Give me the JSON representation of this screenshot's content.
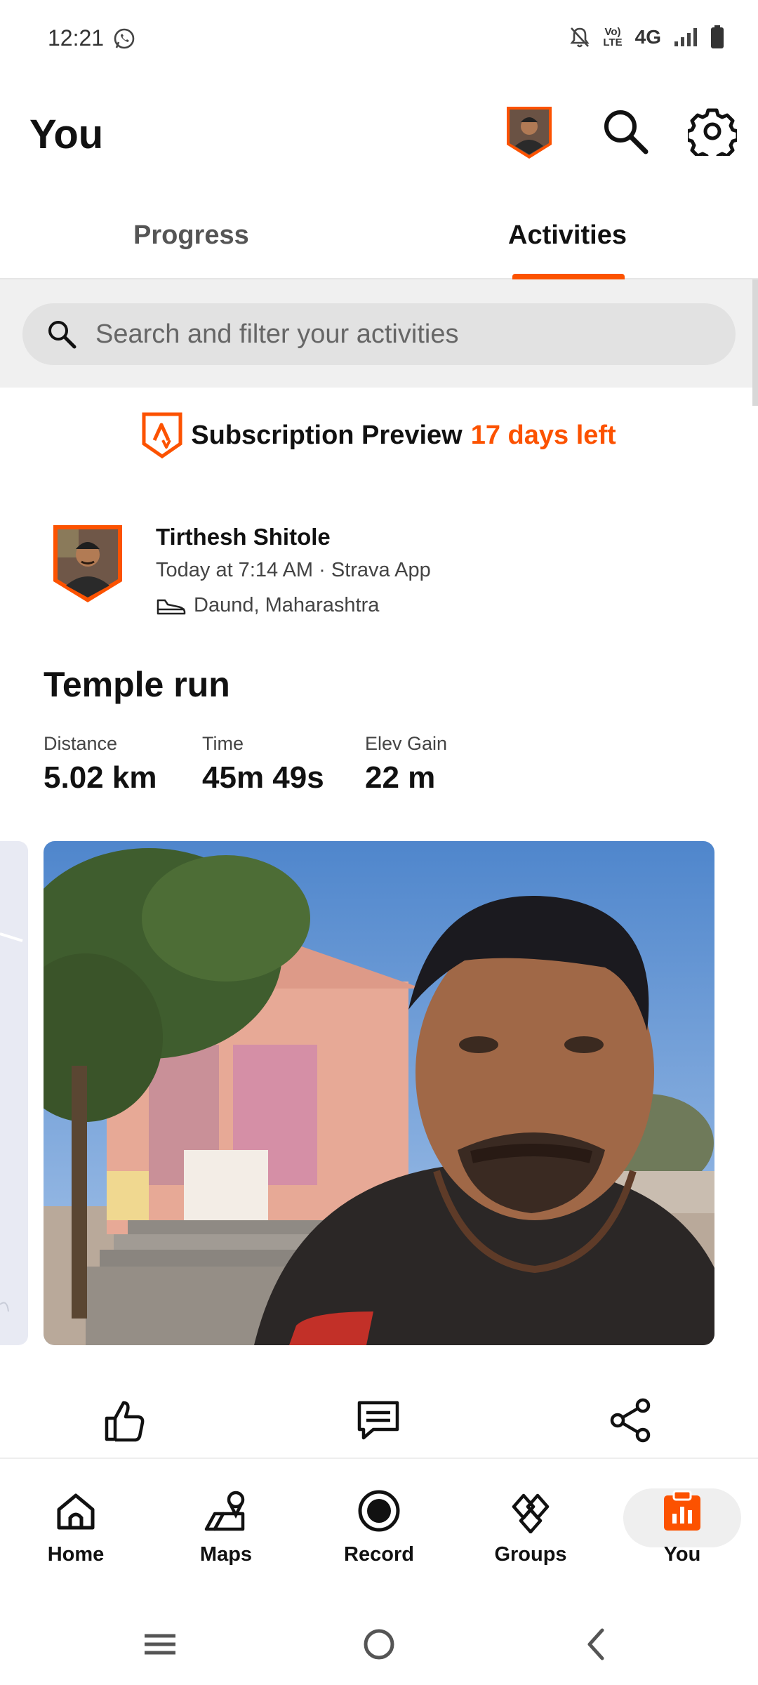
{
  "status_bar": {
    "time": "12:21",
    "lte_line1": "Vo)",
    "lte_line2": "LTE",
    "network": "4G"
  },
  "header": {
    "title": "You"
  },
  "tabs": [
    {
      "label": "Progress",
      "active": false
    },
    {
      "label": "Activities",
      "active": true
    }
  ],
  "search": {
    "placeholder": "Search and filter your activities"
  },
  "subscription": {
    "text": "Subscription Preview",
    "days_left": "17 days left"
  },
  "activity": {
    "athlete_name": "Tirthesh Shitole",
    "meta": "Today at 7:14 AM · Strava App",
    "location": "Daund, Maharashtra",
    "title": "Temple run",
    "stats": [
      {
        "label": "Distance",
        "value": "5.02 km"
      },
      {
        "label": "Time",
        "value": "45m 49s"
      },
      {
        "label": "Elev Gain",
        "value": "22 m"
      }
    ]
  },
  "bottom_nav": [
    {
      "label": "Home",
      "icon": "home-icon"
    },
    {
      "label": "Maps",
      "icon": "maps-icon"
    },
    {
      "label": "Record",
      "icon": "record-icon"
    },
    {
      "label": "Groups",
      "icon": "groups-icon"
    },
    {
      "label": "You",
      "icon": "you-icon",
      "active": true
    }
  ],
  "colors": {
    "accent": "#fc5200",
    "search_bg": "#e2e2e2"
  }
}
